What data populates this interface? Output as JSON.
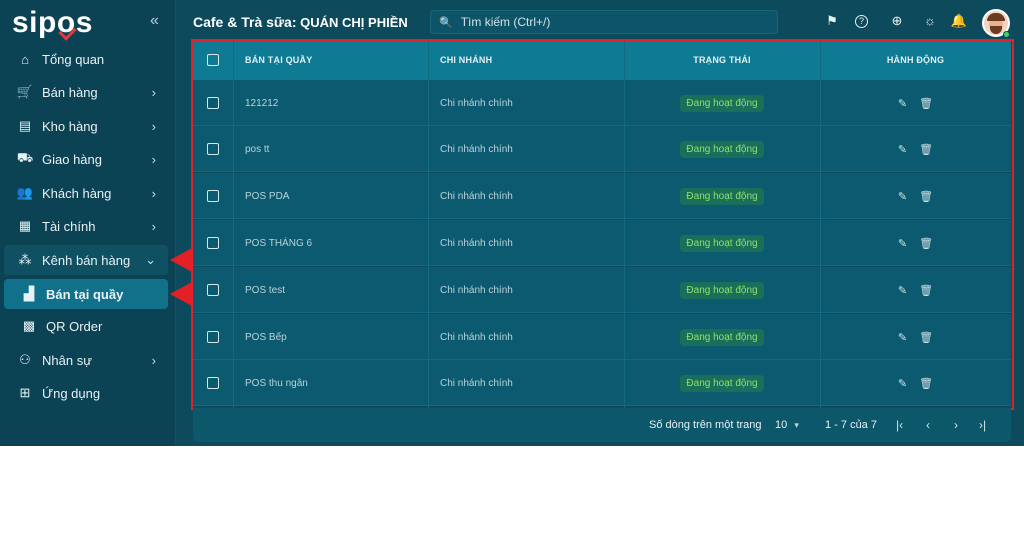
{
  "sidebar": {
    "logo": {
      "left": "si",
      "o": "o",
      "right": "s",
      "p": "p"
    },
    "collapse_icon": "«",
    "items": [
      {
        "label": "Tổng quan",
        "icon": "home-icon",
        "glyph": "⌂",
        "chevron": ""
      },
      {
        "label": "Bán hàng",
        "icon": "cart-icon",
        "glyph": "🛒",
        "chevron": "›"
      },
      {
        "label": "Kho hàng",
        "icon": "inventory-icon",
        "glyph": "▤",
        "chevron": "›"
      },
      {
        "label": "Giao hàng",
        "icon": "truck-icon",
        "glyph": "⛟",
        "chevron": "›"
      },
      {
        "label": "Khách hàng",
        "icon": "people-icon",
        "glyph": "👥",
        "chevron": "›"
      },
      {
        "label": "Tài chính",
        "icon": "calculator-icon",
        "glyph": "▦",
        "chevron": "›"
      },
      {
        "label": "Kênh bán hàng",
        "icon": "channels-icon",
        "glyph": "⁂",
        "chevron": "⌄"
      },
      {
        "label": "Bán tại quầy",
        "icon": "counter-icon",
        "glyph": "▟",
        "chevron": ""
      },
      {
        "label": "QR Order",
        "icon": "qr-icon",
        "glyph": "▩",
        "chevron": ""
      },
      {
        "label": "Nhân sự",
        "icon": "staff-icon",
        "glyph": "⚇",
        "chevron": "›"
      },
      {
        "label": "Ứng dụng",
        "icon": "apps-icon",
        "glyph": "⊞",
        "chevron": ""
      }
    ]
  },
  "header": {
    "title_brand": "Cafe & Trà sữa:",
    "title_store": "QUÁN CHỊ PHIỀN",
    "search_placeholder": "Tìm kiếm (Ctrl+/)",
    "search_glyph": "🔍",
    "icons": [
      {
        "name": "signpost-icon",
        "glyph": "⚑"
      },
      {
        "name": "help-icon",
        "glyph": "?"
      },
      {
        "name": "globe-icon",
        "glyph": "⊕"
      },
      {
        "name": "theme-icon",
        "glyph": "☼"
      },
      {
        "name": "bell-icon",
        "glyph": "🔔"
      }
    ]
  },
  "table": {
    "columns": [
      "BÁN TẠI QUẦY",
      "CHI NHÁNH",
      "TRẠNG THÁI",
      "HÀNH ĐỘNG"
    ],
    "rows": [
      {
        "name": "121212",
        "branch": "Chi nhánh chính",
        "status": "Đang hoạt động"
      },
      {
        "name": "pos tt",
        "branch": "Chi nhánh chính",
        "status": "Đang hoạt động"
      },
      {
        "name": "POS PDA",
        "branch": "Chi nhánh chính",
        "status": "Đang hoạt động"
      },
      {
        "name": "POS THÁNG 6",
        "branch": "Chi nhánh chính",
        "status": "Đang hoạt động"
      },
      {
        "name": "POS test",
        "branch": "Chi nhánh chính",
        "status": "Đang hoạt động"
      },
      {
        "name": "POS Bếp",
        "branch": "Chi nhánh chính",
        "status": "Đang hoạt động"
      },
      {
        "name": "POS thu ngân",
        "branch": "Chi nhánh chính",
        "status": "Đang hoạt động"
      }
    ],
    "edit_glyph": "✎",
    "delete_glyph": "🗑"
  },
  "footer": {
    "rows_per_page_label": "Số dòng trên một trang",
    "rows_per_page_value": "10",
    "dropdown_glyph": "▾",
    "range": "1 - 7 của 7",
    "first": "|‹",
    "prev": "‹",
    "next": "›",
    "last": "›|"
  },
  "colors": {
    "background": "#0c4a5c",
    "active": "#11708a",
    "status_text": "#8fe06c",
    "annotation": "#e32027"
  }
}
